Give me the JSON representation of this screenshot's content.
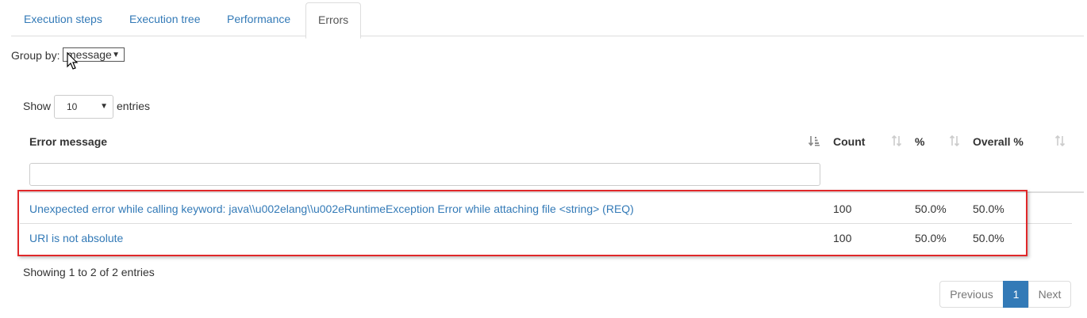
{
  "tabs": [
    {
      "label": "Execution steps"
    },
    {
      "label": "Execution tree"
    },
    {
      "label": "Performance"
    },
    {
      "label": "Errors"
    }
  ],
  "group_by": {
    "label": "Group by:",
    "value": "message"
  },
  "length": {
    "show_label": "Show",
    "value": "10",
    "entries_label": "entries"
  },
  "table": {
    "columns": [
      "Error message",
      "Count",
      "%",
      "Overall %"
    ],
    "filter_value": "",
    "rows": [
      {
        "message": "Unexpected error while calling keyword: java\\\\u002elang\\\\u002eRuntimeException Error while attaching file <string> (REQ)",
        "count": "100",
        "pct": "50.0%",
        "overall": "50.0%"
      },
      {
        "message": "URI is not absolute",
        "count": "100",
        "pct": "50.0%",
        "overall": "50.0%"
      }
    ]
  },
  "info": "Showing 1 to 2 of 2 entries",
  "pagination": {
    "previous": "Previous",
    "current": "1",
    "next": "Next"
  },
  "colors": {
    "link": "#337ab7",
    "highlight": "#e0282a",
    "active_page": "#337ab7"
  }
}
